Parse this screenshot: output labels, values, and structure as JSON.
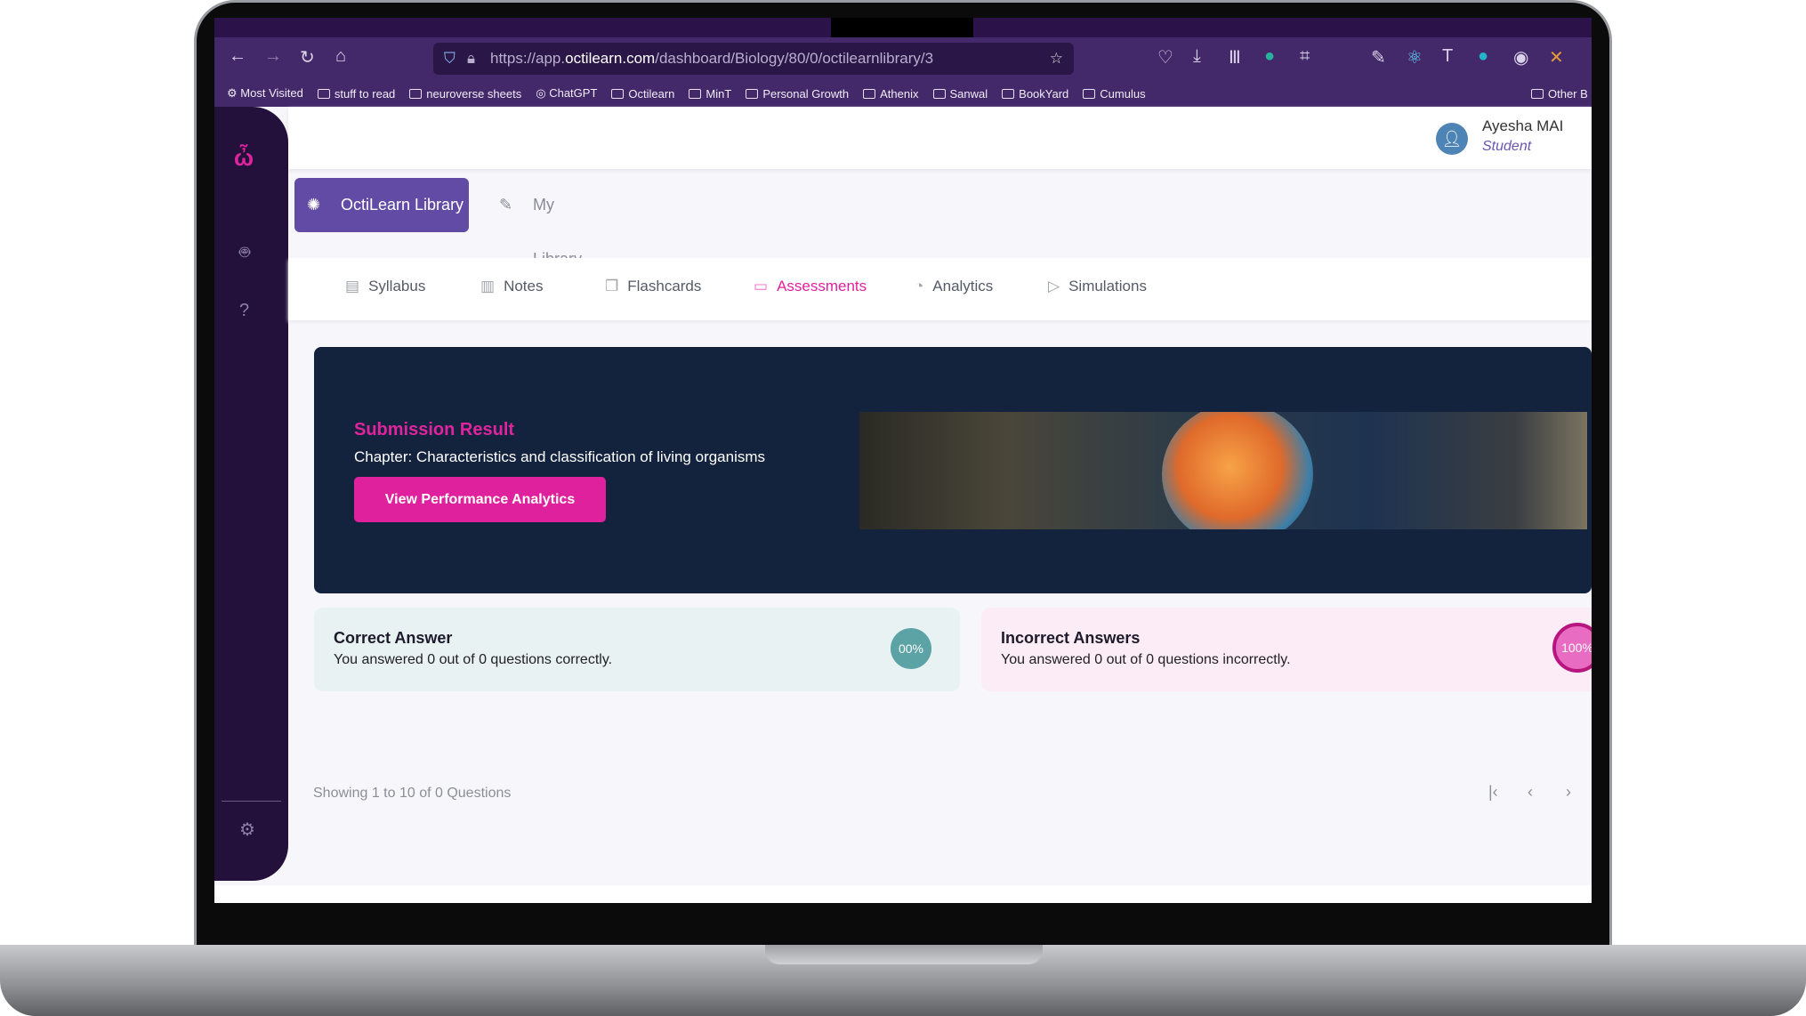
{
  "browser": {
    "url_prefix": "https://app.",
    "url_domain": "octilearn.com",
    "url_path": "/dashboard/Biology/80/0/octilearnlibrary/3",
    "bookmarks": [
      "Most Visited",
      "stuff to read",
      "neuroverse sheets",
      "ChatGPT",
      "Octilearn",
      "MinT",
      "Personal Growth",
      "Athenix",
      "Sanwal",
      "BookYard",
      "Cumulus"
    ],
    "other_bookmarks": "Other B"
  },
  "user": {
    "name": "Ayesha MAI",
    "role": "Student"
  },
  "library_tabs": {
    "octilearn": "OctiLearn Library",
    "my": "My Library"
  },
  "subtabs": [
    "Syllabus",
    "Notes",
    "Flashcards",
    "Assessments",
    "Analytics",
    "Simulations"
  ],
  "active_subtab": "Assessments",
  "banner": {
    "title": "Submission Result",
    "chapter": "Chapter: Characteristics and classification of living organisms",
    "button": "View Performance Analytics"
  },
  "cards": {
    "correct": {
      "title": "Correct Answer",
      "text": "You answered 0 out of 0 questions correctly.",
      "badge": "00%"
    },
    "incorrect": {
      "title": "Incorrect Answers",
      "text": "You answered 0 out of 0 questions incorrectly.",
      "badge": "100%"
    }
  },
  "pagination": {
    "showing": "Showing 1 to 10 of 0 Questions"
  },
  "colors": {
    "accent": "#e0219d",
    "primary": "#624ba4",
    "sidebar": "#23103b",
    "banner": "#13233e",
    "correct": "#5ba3a5",
    "incorrect": "#e8268f"
  }
}
